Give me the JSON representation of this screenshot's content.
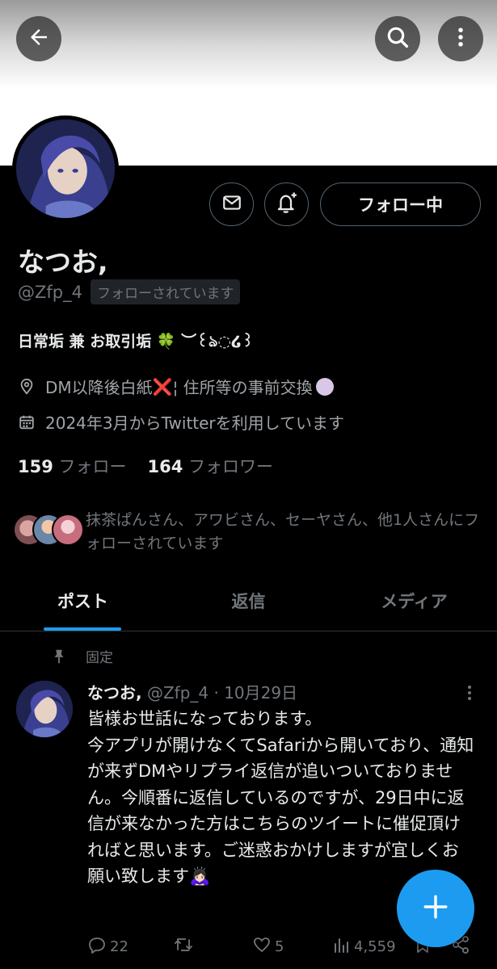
{
  "colors": {
    "accent": "#1d9bf0",
    "text_primary": "#e7e9ea",
    "text_secondary": "#71767b",
    "background": "#000000",
    "border": "#2f3336"
  },
  "topbar": {
    "back_icon": "arrow-left-icon",
    "search_icon": "search-icon",
    "more_icon": "more-vertical-icon"
  },
  "profile": {
    "display_name": "なつお,",
    "handle": "@Zfp_4",
    "follows_you": "フォローされています",
    "bio_text": "日常垢 兼 お取引垢",
    "bio_clover": "🍀",
    "bio_tail": "︶꒰ঌ◌໒꒱",
    "location_main": "DM以降後白紙",
    "location_cross": "❌",
    "location_rest": "¦ 住所等の事前交換",
    "joined": "2024年3月からTwitterを利用しています",
    "following_count": "159",
    "following_label": "フォロー",
    "followers_count": "164",
    "followers_label": "フォロワー",
    "followed_by_text": "抹茶ぱんさん、アワビさん、セーヤさん、他1人さんにフォローされています",
    "following_button": "フォロー中"
  },
  "tabs": [
    {
      "label": "ポスト",
      "active": true
    },
    {
      "label": "返信",
      "active": false
    },
    {
      "label": "メディア",
      "active": false
    }
  ],
  "pinned_tweet": {
    "pinned_label": "固定",
    "name": "なつお,",
    "handle_date": "@Zfp_4 · 10月29日",
    "text": "皆様お世話になっております。\n今アプリが開けなくてSafariから開いており、通知が来ずDMやリプライ返信が追いついておりません。今順番に返信しているのですが、29日中に返信が来なかった方はこちらのツイートに催促頂ければと思います。ご迷惑おかけしますが宜しくお願い致します🙇🏻‍♀️",
    "replies": "22",
    "likes": "5",
    "views": "4,559"
  }
}
